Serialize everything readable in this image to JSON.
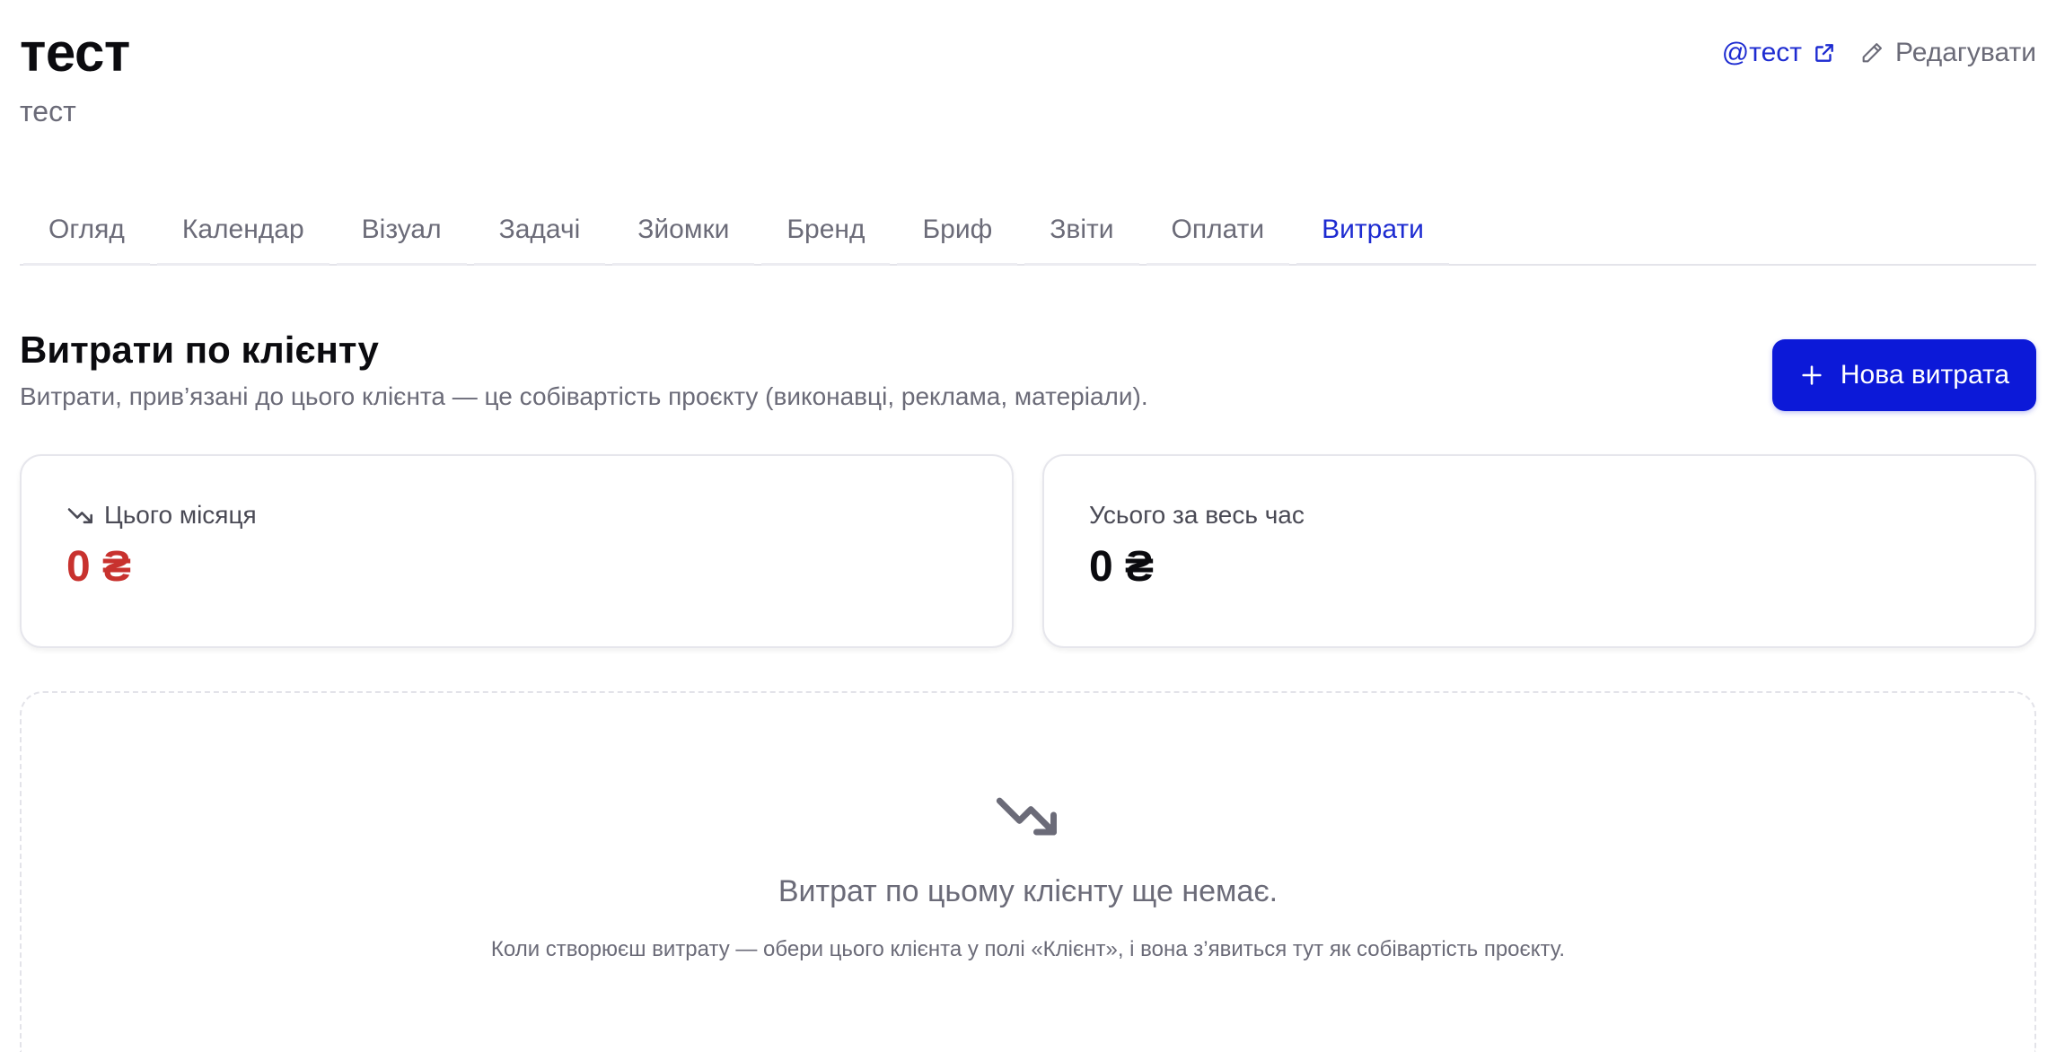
{
  "header": {
    "title": "тест",
    "subtitle": "тест",
    "handle_link": "@тест",
    "edit_label": "Редагувати"
  },
  "tabs": [
    {
      "label": "Огляд",
      "active": false
    },
    {
      "label": "Календар",
      "active": false
    },
    {
      "label": "Візуал",
      "active": false
    },
    {
      "label": "Задачі",
      "active": false
    },
    {
      "label": "Зйомки",
      "active": false
    },
    {
      "label": "Бренд",
      "active": false
    },
    {
      "label": "Бриф",
      "active": false
    },
    {
      "label": "Звіти",
      "active": false
    },
    {
      "label": "Оплати",
      "active": false
    },
    {
      "label": "Витрати",
      "active": true
    }
  ],
  "section": {
    "title": "Витрати по клієнту",
    "description": "Витрати, прив’язані до цього клієнта — це собівартість проєкту (виконавці, реклама, матеріали).",
    "new_button_label": "Нова витрата"
  },
  "cards": {
    "month": {
      "label": "Цього місяця",
      "value": "0 ₴",
      "icon": "trending-down-icon"
    },
    "total": {
      "label": "Усього за весь час",
      "value": "0 ₴"
    }
  },
  "empty_state": {
    "icon": "trending-down-icon",
    "title": "Витрат по цьому клієнту ще немає.",
    "description": "Коли створюєш витрату — обери цього клієнта у полі «Клієнт», і вона з’явиться тут як собівартість проєкту."
  },
  "colors": {
    "accent": "#0c19d8",
    "link": "#1d2bd1",
    "negative": "#c8322e",
    "muted_text": "#6b6b78"
  }
}
